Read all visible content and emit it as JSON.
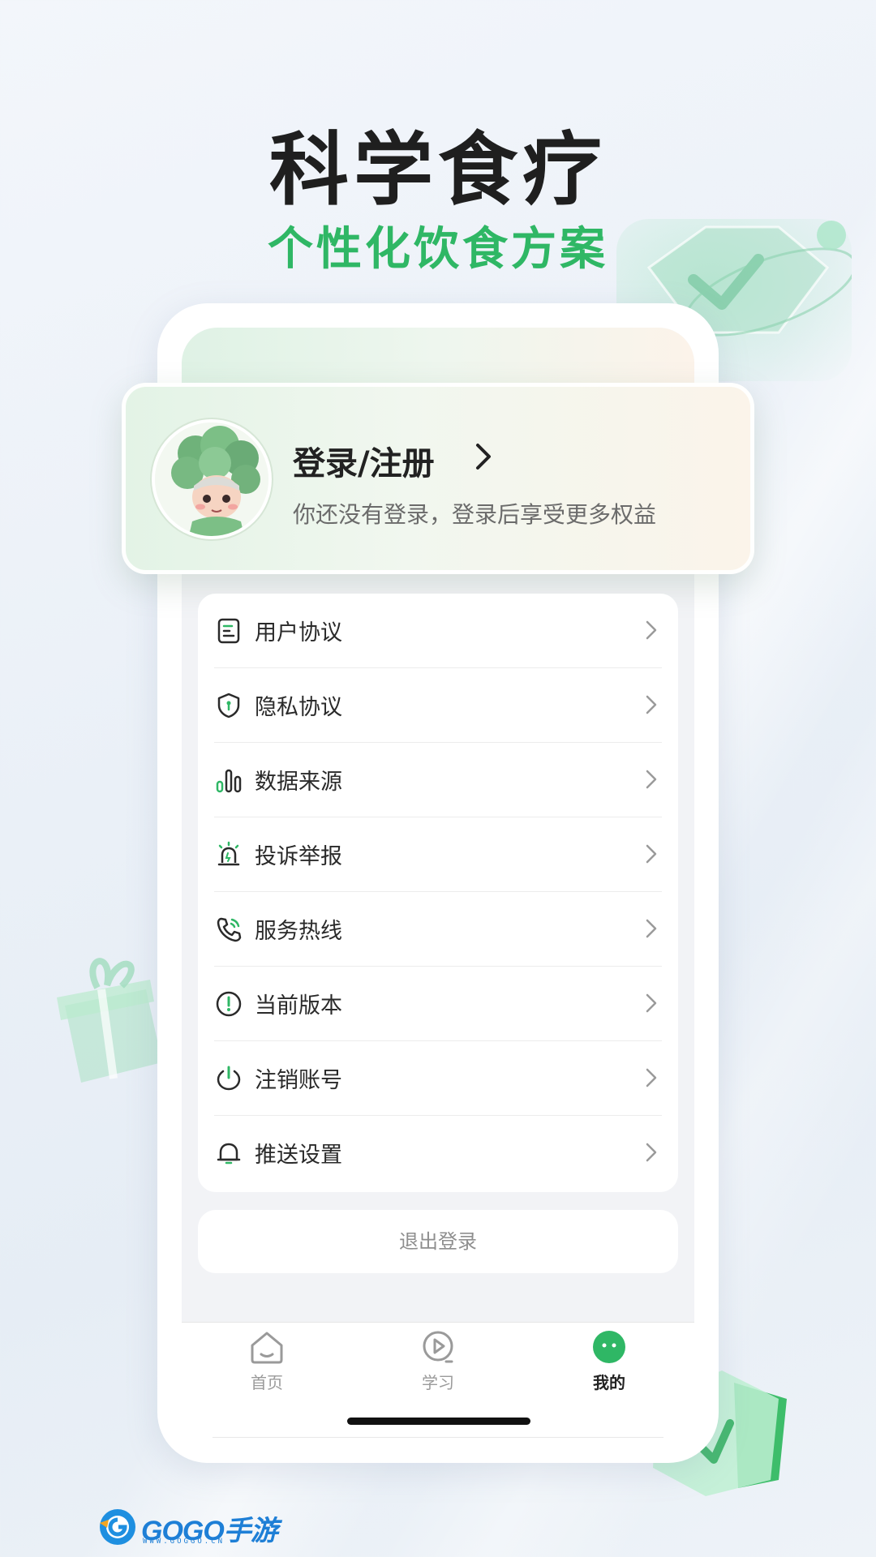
{
  "hero": {
    "title": "科学食疗",
    "subtitle": "个性化饮食方案"
  },
  "profile": {
    "login_title": "登录/注册",
    "login_desc": "你还没有登录，登录后享受更多权益",
    "avatar_icon": "broccoli-mascot-avatar"
  },
  "menu": {
    "items": [
      {
        "label": "用户协议",
        "icon": "document-icon"
      },
      {
        "label": "隐私协议",
        "icon": "shield-icon"
      },
      {
        "label": "数据来源",
        "icon": "bar-chart-icon"
      },
      {
        "label": "投诉举报",
        "icon": "alarm-icon"
      },
      {
        "label": "服务热线",
        "icon": "phone-icon"
      },
      {
        "label": "当前版本",
        "icon": "info-icon"
      },
      {
        "label": "注销账号",
        "icon": "power-icon"
      },
      {
        "label": "推送设置",
        "icon": "bell-icon"
      }
    ]
  },
  "logout_label": "退出登录",
  "tabbar": {
    "tabs": [
      {
        "label": "首页",
        "icon": "home-icon",
        "active": false
      },
      {
        "label": "学习",
        "icon": "play-icon",
        "active": false
      },
      {
        "label": "我的",
        "icon": "profile-face-icon",
        "active": true
      }
    ]
  },
  "watermark": {
    "main": "GOGO手游网",
    "sub": "WWW.GOGGO.CN"
  },
  "colors": {
    "accent": "#2fb765",
    "title": "#1f1f1f",
    "background": "#eaf0f7"
  }
}
